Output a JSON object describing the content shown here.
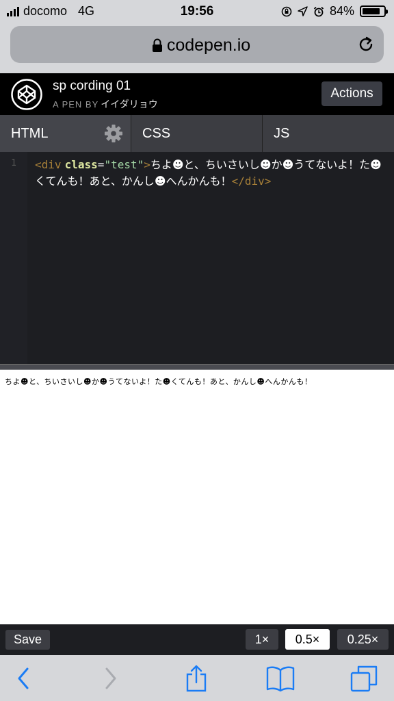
{
  "status_bar": {
    "carrier": "docomo",
    "network": "4G",
    "time": "19:56",
    "battery_percent": "84%",
    "battery_level": 0.84
  },
  "browser": {
    "url": "codepen.io"
  },
  "pen": {
    "title": "sp cording 01",
    "byline_prefix": "A PEN BY",
    "author": "イイダリョウ",
    "actions_label": "Actions"
  },
  "tabs": [
    {
      "label": "HTML",
      "active": true
    },
    {
      "label": "CSS",
      "active": false
    },
    {
      "label": "JS",
      "active": false
    }
  ],
  "editor": {
    "line_number": "1",
    "tag_open": "<div",
    "attr_name": "class",
    "attr_eq": "=",
    "attr_value": "\"test\"",
    "tag_close_bracket": ">",
    "text": "ちよ☻と、ちいさいし☻か☻うてないよ！た☻くてんも！あと、かんし☻へんかんも！",
    "tag_end": "</div>"
  },
  "preview": {
    "text": "ちよ☻と、ちいさいし☻か☻うてないよ！た☻くてんも！あと、かんし☻へんかんも！"
  },
  "footer": {
    "save_label": "Save",
    "zoom_options": [
      "1×",
      "0.5×",
      "0.25×"
    ],
    "zoom_selected": "0.5×"
  },
  "colors": {
    "codepen_black": "#000000",
    "editor_bg": "#1d1e22",
    "tag_color": "#a88038",
    "attr_color": "#dde6a0",
    "string_color": "#a3d7a5",
    "ios_blue": "#1a7cf5"
  },
  "icons": {
    "lock": "lock-icon",
    "reload": "reload-icon",
    "codepen_logo": "codepen-logo-icon",
    "settings": "gear-icon",
    "back": "chevron-left-icon",
    "forward": "chevron-right-icon",
    "share": "share-icon",
    "bookmarks": "book-icon",
    "tabs": "tabs-icon"
  }
}
